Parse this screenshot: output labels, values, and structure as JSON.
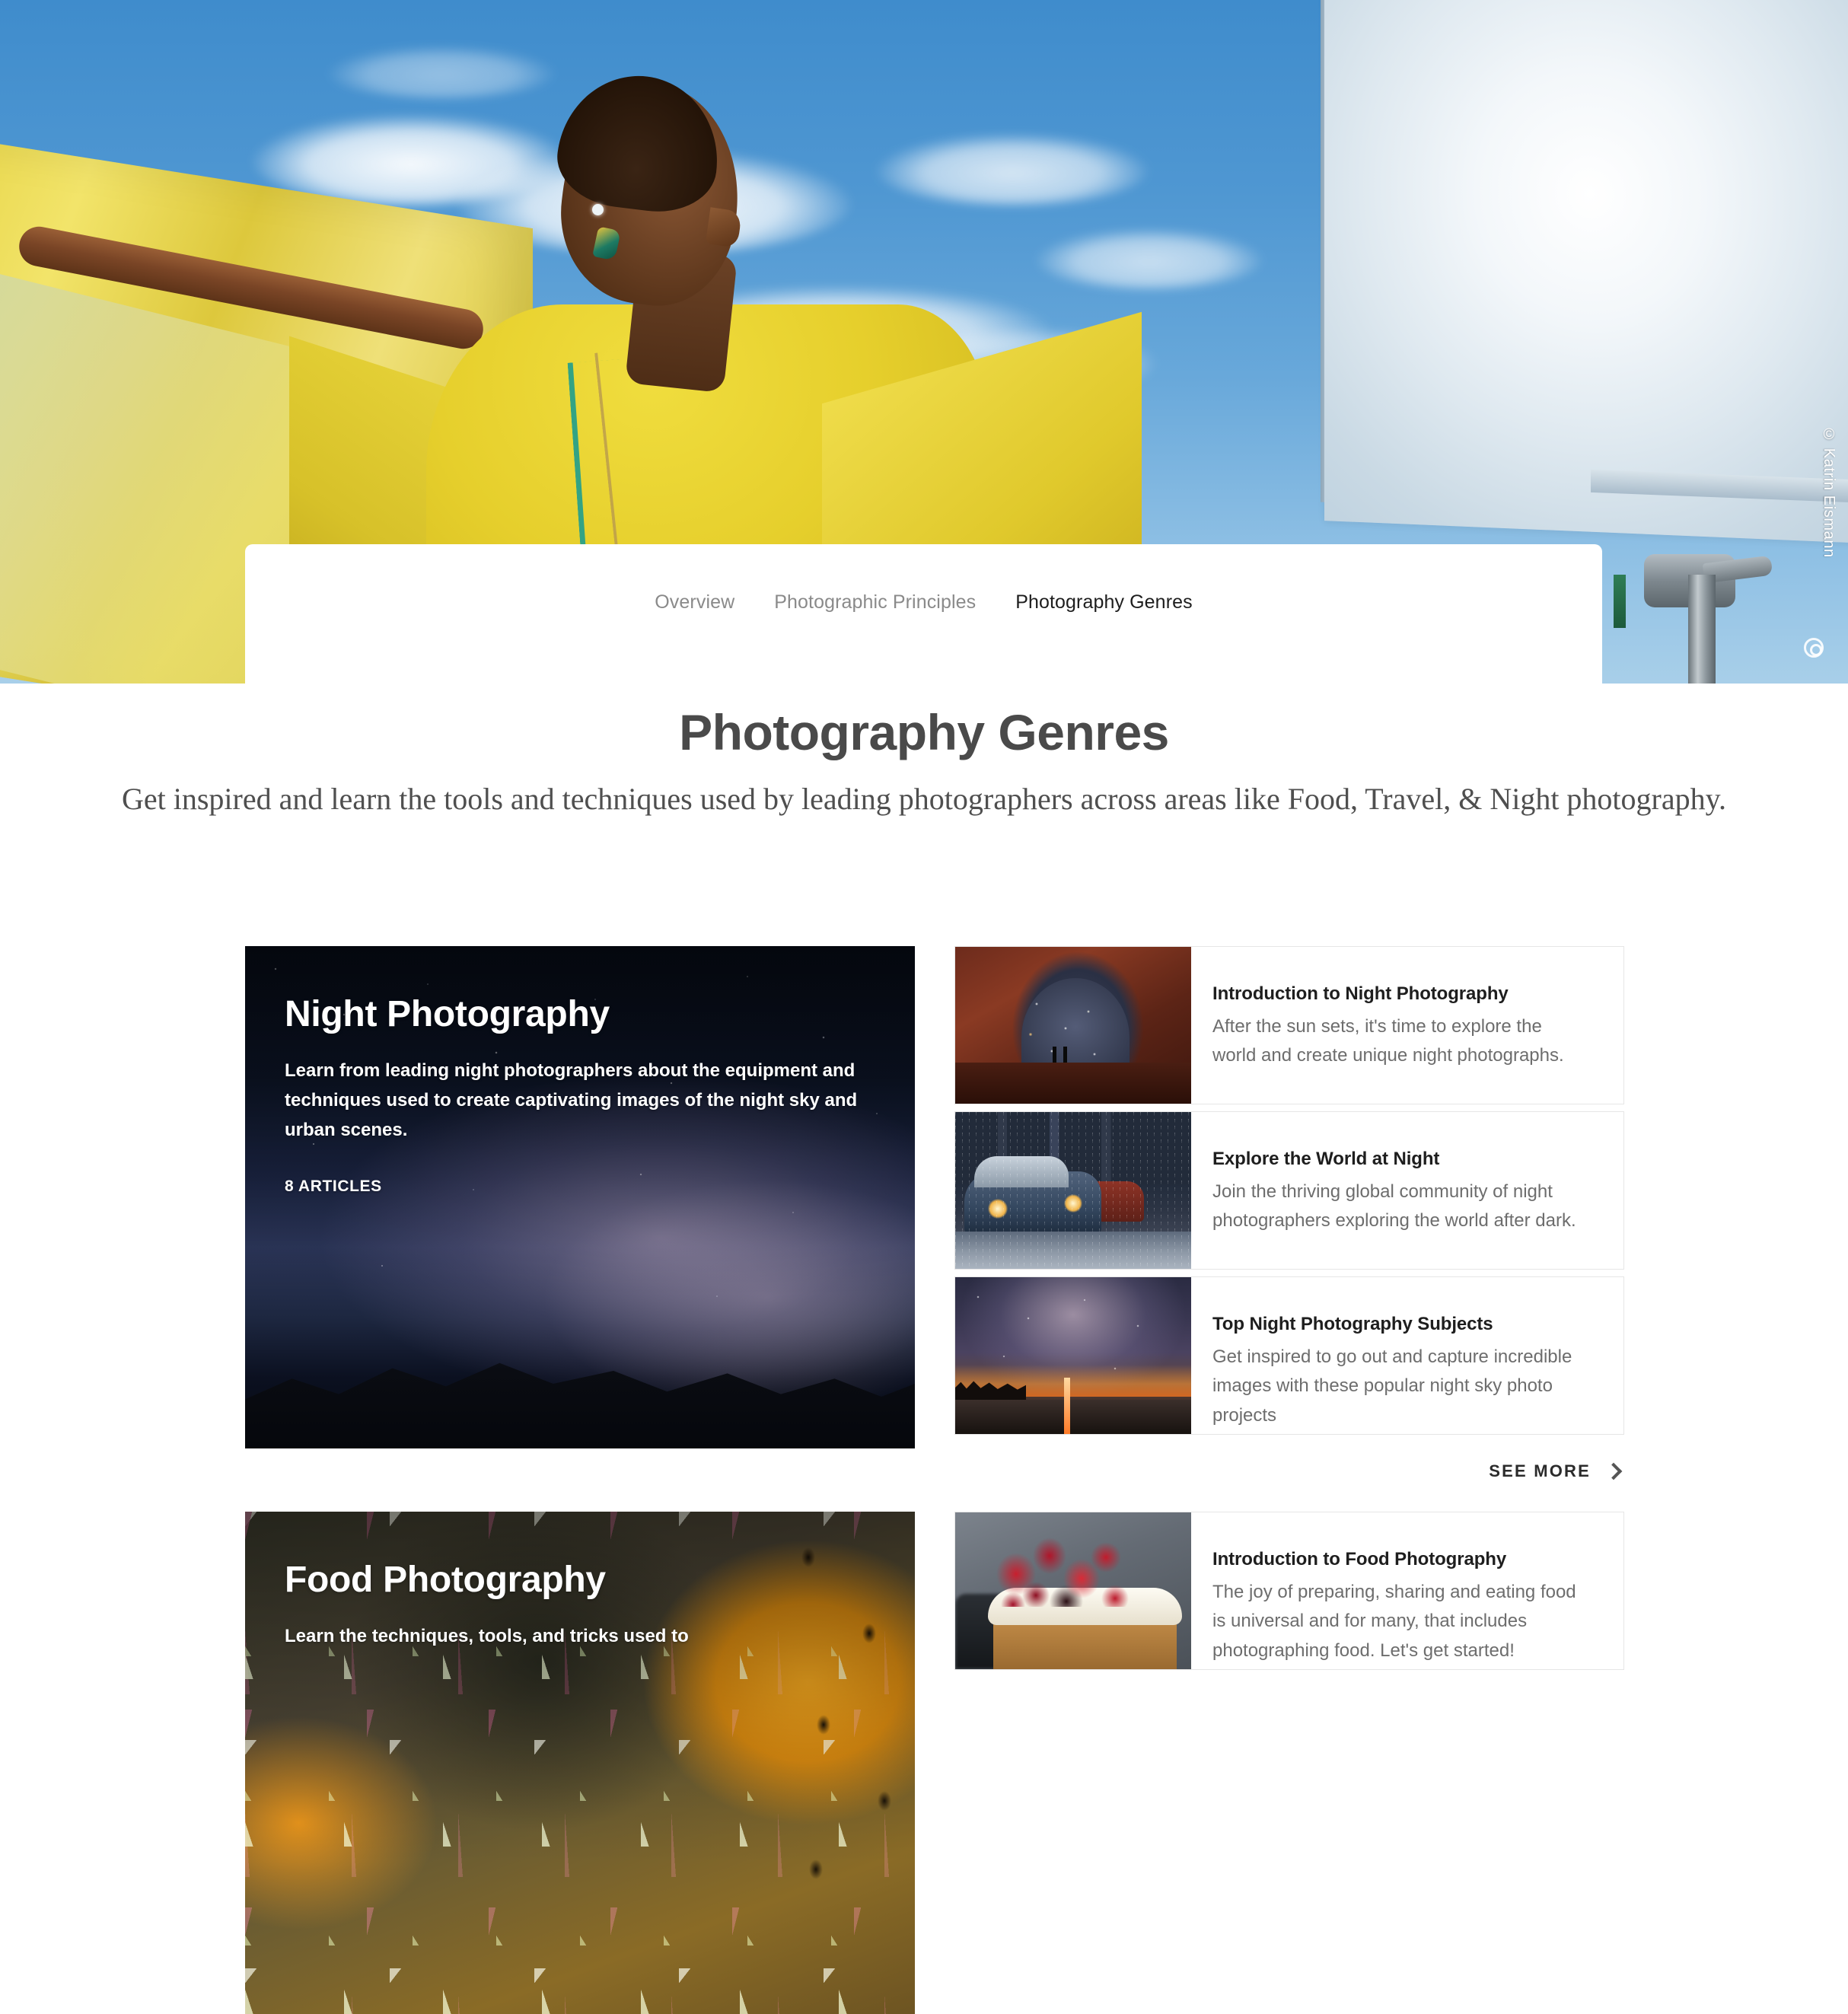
{
  "hero": {
    "credit": "© Katrin Eismann",
    "alt": "Fashion model in flowing yellow dress against blue sky with studio scrim"
  },
  "nav": {
    "tabs": [
      {
        "label": "Overview",
        "active": false
      },
      {
        "label": "Photographic Principles",
        "active": false
      },
      {
        "label": "Photography Genres",
        "active": true
      }
    ]
  },
  "page": {
    "title": "Photography Genres",
    "subtitle": "Get inspired and learn the tools and techniques used by leading photographers across areas like Food, Travel, & Night photography."
  },
  "sections": [
    {
      "genre": {
        "title": "Night Photography",
        "description": "Learn from leading night photographers about the equipment and techniques used to create captivating images of the night sky and urban scenes.",
        "count": "8 ARTICLES"
      },
      "articles": [
        {
          "title": "Introduction to Night Photography",
          "description": "After the sun sets, it's time to explore the world and create unique night photographs.",
          "thumb": "arch-night-sky-thumbnail"
        },
        {
          "title": "Explore the World at Night",
          "description": "Join the thriving global community of night photographers exploring the world after dark.",
          "thumb": "vintage-cars-rain-thumbnail"
        },
        {
          "title": "Top Night Photography Subjects",
          "description": "Get inspired to go out and capture incredible images with these popular night sky photo projects",
          "thumb": "milky-way-lake-thumbnail"
        }
      ],
      "see_more": "SEE MORE"
    },
    {
      "genre": {
        "title": "Food Photography",
        "description": "Learn the techniques, tools, and tricks used to",
        "count": ""
      },
      "articles": [
        {
          "title": "Introduction to Food Photography",
          "description": "The joy of preparing, sharing and eating food is universal and for many, that includes photographing food. Let's get started!",
          "thumb": "berry-cake-thumbnail"
        }
      ],
      "see_more": ""
    }
  ],
  "colors": {
    "active_tab": "#1d1d1d",
    "inactive_tab": "#8a8a8a",
    "underline_active": "#2b2b2b",
    "underline_track": "#ececec",
    "title": "#4a4a4a",
    "body_text": "#6d6d6d",
    "card_border": "#e6e6e6"
  }
}
